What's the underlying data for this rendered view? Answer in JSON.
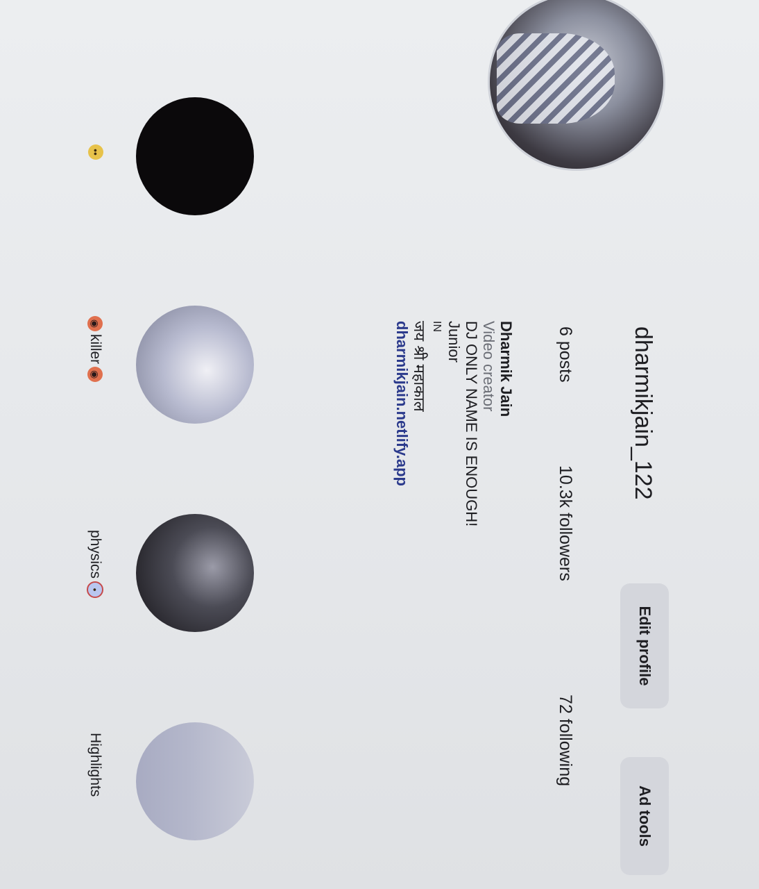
{
  "profile": {
    "username": "dharmikjain_122",
    "edit_profile_label": "Edit profile",
    "ad_tools_label": "Ad tools",
    "stats": {
      "posts": "6 posts",
      "followers": "10.3k followers",
      "following": "72 following"
    },
    "bio": {
      "name": "Dharmik Jain",
      "category": "Video creator",
      "line1": "DJ ONLY NAME IS ENOUGH!",
      "line2": "Junior",
      "line3": "IN",
      "line4": "जय श्री महाकाल",
      "link": "dharmikjain.netlify.app"
    }
  },
  "highlights": [
    {
      "label": "",
      "emoji": "neutral-face-icon"
    },
    {
      "label": "killer",
      "emoji": "devil-face-icon"
    },
    {
      "label": "physics",
      "emoji": "thinking-face-icon"
    },
    {
      "label": "Highlights",
      "emoji": ""
    }
  ]
}
